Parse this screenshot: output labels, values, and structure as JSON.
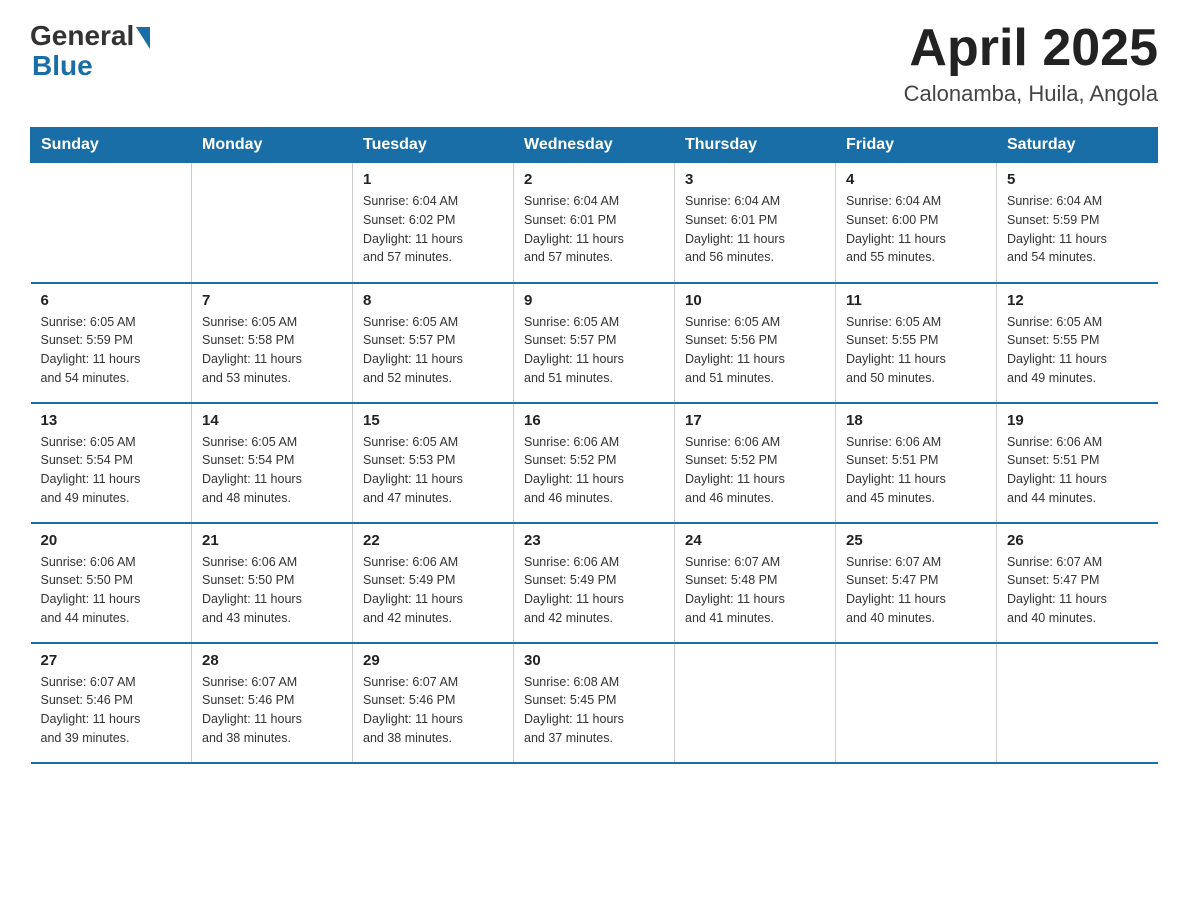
{
  "logo": {
    "general": "General",
    "blue": "Blue",
    "subtitle": "Blue"
  },
  "header": {
    "month": "April 2025",
    "location": "Calonamba, Huila, Angola"
  },
  "days_of_week": [
    "Sunday",
    "Monday",
    "Tuesday",
    "Wednesday",
    "Thursday",
    "Friday",
    "Saturday"
  ],
  "weeks": [
    [
      {
        "day": "",
        "info": ""
      },
      {
        "day": "",
        "info": ""
      },
      {
        "day": "1",
        "info": "Sunrise: 6:04 AM\nSunset: 6:02 PM\nDaylight: 11 hours\nand 57 minutes."
      },
      {
        "day": "2",
        "info": "Sunrise: 6:04 AM\nSunset: 6:01 PM\nDaylight: 11 hours\nand 57 minutes."
      },
      {
        "day": "3",
        "info": "Sunrise: 6:04 AM\nSunset: 6:01 PM\nDaylight: 11 hours\nand 56 minutes."
      },
      {
        "day": "4",
        "info": "Sunrise: 6:04 AM\nSunset: 6:00 PM\nDaylight: 11 hours\nand 55 minutes."
      },
      {
        "day": "5",
        "info": "Sunrise: 6:04 AM\nSunset: 5:59 PM\nDaylight: 11 hours\nand 54 minutes."
      }
    ],
    [
      {
        "day": "6",
        "info": "Sunrise: 6:05 AM\nSunset: 5:59 PM\nDaylight: 11 hours\nand 54 minutes."
      },
      {
        "day": "7",
        "info": "Sunrise: 6:05 AM\nSunset: 5:58 PM\nDaylight: 11 hours\nand 53 minutes."
      },
      {
        "day": "8",
        "info": "Sunrise: 6:05 AM\nSunset: 5:57 PM\nDaylight: 11 hours\nand 52 minutes."
      },
      {
        "day": "9",
        "info": "Sunrise: 6:05 AM\nSunset: 5:57 PM\nDaylight: 11 hours\nand 51 minutes."
      },
      {
        "day": "10",
        "info": "Sunrise: 6:05 AM\nSunset: 5:56 PM\nDaylight: 11 hours\nand 51 minutes."
      },
      {
        "day": "11",
        "info": "Sunrise: 6:05 AM\nSunset: 5:55 PM\nDaylight: 11 hours\nand 50 minutes."
      },
      {
        "day": "12",
        "info": "Sunrise: 6:05 AM\nSunset: 5:55 PM\nDaylight: 11 hours\nand 49 minutes."
      }
    ],
    [
      {
        "day": "13",
        "info": "Sunrise: 6:05 AM\nSunset: 5:54 PM\nDaylight: 11 hours\nand 49 minutes."
      },
      {
        "day": "14",
        "info": "Sunrise: 6:05 AM\nSunset: 5:54 PM\nDaylight: 11 hours\nand 48 minutes."
      },
      {
        "day": "15",
        "info": "Sunrise: 6:05 AM\nSunset: 5:53 PM\nDaylight: 11 hours\nand 47 minutes."
      },
      {
        "day": "16",
        "info": "Sunrise: 6:06 AM\nSunset: 5:52 PM\nDaylight: 11 hours\nand 46 minutes."
      },
      {
        "day": "17",
        "info": "Sunrise: 6:06 AM\nSunset: 5:52 PM\nDaylight: 11 hours\nand 46 minutes."
      },
      {
        "day": "18",
        "info": "Sunrise: 6:06 AM\nSunset: 5:51 PM\nDaylight: 11 hours\nand 45 minutes."
      },
      {
        "day": "19",
        "info": "Sunrise: 6:06 AM\nSunset: 5:51 PM\nDaylight: 11 hours\nand 44 minutes."
      }
    ],
    [
      {
        "day": "20",
        "info": "Sunrise: 6:06 AM\nSunset: 5:50 PM\nDaylight: 11 hours\nand 44 minutes."
      },
      {
        "day": "21",
        "info": "Sunrise: 6:06 AM\nSunset: 5:50 PM\nDaylight: 11 hours\nand 43 minutes."
      },
      {
        "day": "22",
        "info": "Sunrise: 6:06 AM\nSunset: 5:49 PM\nDaylight: 11 hours\nand 42 minutes."
      },
      {
        "day": "23",
        "info": "Sunrise: 6:06 AM\nSunset: 5:49 PM\nDaylight: 11 hours\nand 42 minutes."
      },
      {
        "day": "24",
        "info": "Sunrise: 6:07 AM\nSunset: 5:48 PM\nDaylight: 11 hours\nand 41 minutes."
      },
      {
        "day": "25",
        "info": "Sunrise: 6:07 AM\nSunset: 5:47 PM\nDaylight: 11 hours\nand 40 minutes."
      },
      {
        "day": "26",
        "info": "Sunrise: 6:07 AM\nSunset: 5:47 PM\nDaylight: 11 hours\nand 40 minutes."
      }
    ],
    [
      {
        "day": "27",
        "info": "Sunrise: 6:07 AM\nSunset: 5:46 PM\nDaylight: 11 hours\nand 39 minutes."
      },
      {
        "day": "28",
        "info": "Sunrise: 6:07 AM\nSunset: 5:46 PM\nDaylight: 11 hours\nand 38 minutes."
      },
      {
        "day": "29",
        "info": "Sunrise: 6:07 AM\nSunset: 5:46 PM\nDaylight: 11 hours\nand 38 minutes."
      },
      {
        "day": "30",
        "info": "Sunrise: 6:08 AM\nSunset: 5:45 PM\nDaylight: 11 hours\nand 37 minutes."
      },
      {
        "day": "",
        "info": ""
      },
      {
        "day": "",
        "info": ""
      },
      {
        "day": "",
        "info": ""
      }
    ]
  ]
}
